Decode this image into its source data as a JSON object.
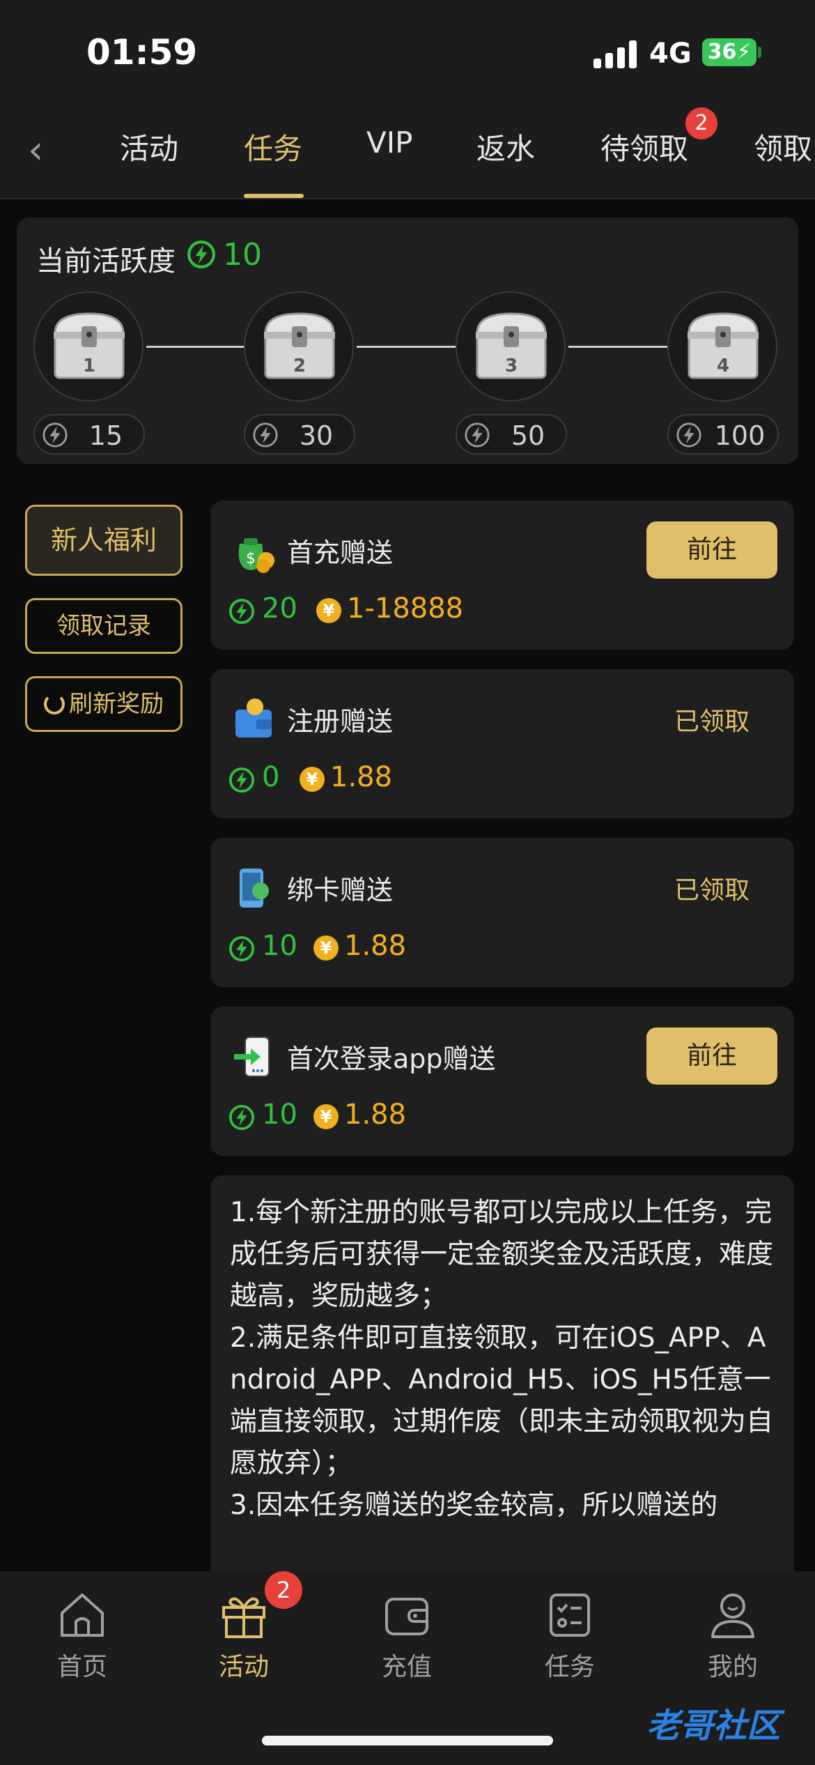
{
  "status_bar": {
    "time": "01:59",
    "network": "4G",
    "battery": "36"
  },
  "tabs": [
    {
      "label": "活动"
    },
    {
      "label": "任务"
    },
    {
      "label": "VIP"
    },
    {
      "label": "返水"
    },
    {
      "label": "待领取",
      "badge": "2"
    },
    {
      "label": "领取"
    }
  ],
  "activity": {
    "title": "当前活跃度",
    "current": "10",
    "chests": [
      {
        "num": "1",
        "required": "15"
      },
      {
        "num": "2",
        "required": "30"
      },
      {
        "num": "3",
        "required": "50"
      },
      {
        "num": "4",
        "required": "100"
      }
    ]
  },
  "sidebar": {
    "newbie": "新人福利",
    "records": "领取记录",
    "refresh": "刷新奖励"
  },
  "tasks": [
    {
      "name": "首充赠送",
      "activity": "20",
      "bonus": "1-18888",
      "action": "前往",
      "claimed": false
    },
    {
      "name": "注册赠送",
      "activity": "0",
      "bonus": "1.88",
      "action": "已领取",
      "claimed": true
    },
    {
      "name": "绑卡赠送",
      "activity": "10",
      "bonus": "1.88",
      "action": "已领取",
      "claimed": true
    },
    {
      "name": "首次登录app赠送",
      "activity": "10",
      "bonus": "1.88",
      "action": "前往",
      "claimed": false
    }
  ],
  "coin_symbol": "¥",
  "rules_text": "1.每个新注册的账号都可以完成以上任务，完成任务后可获得一定金额奖金及活跃度，难度越高，奖励越多；\n2.满足条件即可直接领取，可在iOS_APP、Android_APP、Android_H5、iOS_H5任意一端直接领取，过期作废（即未主动领取视为自愿放弃）；\n3.因本任务赠送的奖金较高，所以赠送的",
  "bottom_nav": [
    {
      "label": "首页"
    },
    {
      "label": "活动",
      "badge": "2"
    },
    {
      "label": "充值"
    },
    {
      "label": "任务"
    },
    {
      "label": "我的"
    }
  ],
  "watermark": "老哥社区",
  "colors": {
    "accent": "#e0bf6a",
    "activity_green": "#2fc23c",
    "coin": "#f0b020",
    "badge": "#e8403a",
    "panel": "#1f1f1f"
  }
}
